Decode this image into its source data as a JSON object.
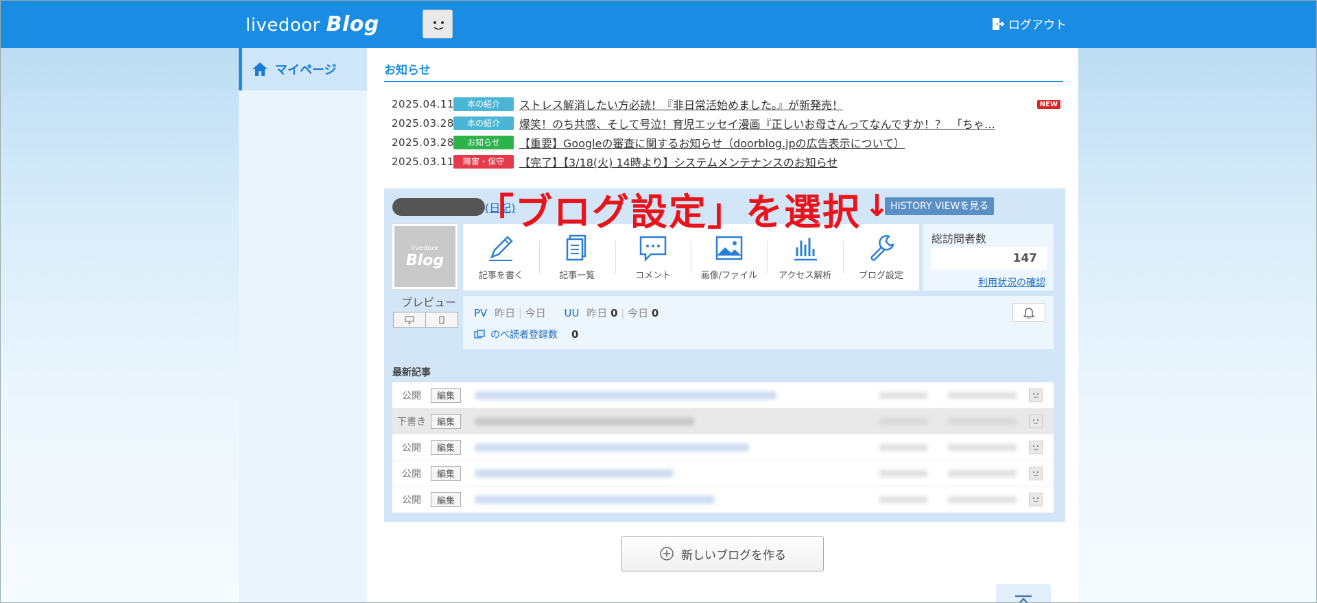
{
  "header": {
    "logo_text": "livedoor",
    "logo_blog": "Blog",
    "logout_label": "ログアウト"
  },
  "sidebar": {
    "items": [
      {
        "label": "マイページ",
        "icon": "home-icon"
      }
    ]
  },
  "news": {
    "title": "お知らせ",
    "items": [
      {
        "date": "2025.04.11",
        "tag": "本の紹介",
        "tag_color": "#4bb5d6",
        "text": "ストレス解消したい方必読！『非日常活始めました。』が新発売！",
        "new": "NEW"
      },
      {
        "date": "2025.03.28",
        "tag": "本の紹介",
        "tag_color": "#4bb5d6",
        "text": "爆笑！のち共感、そして号泣！育児エッセイ漫画『正しいお母さんってなんですか！？　「ちゃ…",
        "new": ""
      },
      {
        "date": "2025.03.28",
        "tag": "お知らせ",
        "tag_color": "#2eb24a",
        "text": "【重要】Googleの審査に関するお知らせ（doorblog.jpの広告表示について）",
        "new": ""
      },
      {
        "date": "2025.03.11",
        "tag": "障害・保守",
        "tag_color": "#e53a4b",
        "text": "【完了】【3/18(火) 14時より】システムメンテナンスのお知らせ",
        "new": ""
      }
    ]
  },
  "blog": {
    "nikki": "(日記)",
    "history_button": "HISTORY VIEWを見る",
    "annotation": "「ブログ設定」を選択",
    "annotation_arrow": "↓",
    "thumb_small": "livedoor",
    "thumb_large": "Blog",
    "preview_label": "プレビュー",
    "actions": [
      {
        "label": "記事を書く",
        "icon": "pencil-icon"
      },
      {
        "label": "記事一覧",
        "icon": "documents-icon"
      },
      {
        "label": "コメント",
        "icon": "comment-icon"
      },
      {
        "label": "画像/ファイル",
        "icon": "image-icon"
      },
      {
        "label": "アクセス解析",
        "icon": "chart-icon"
      },
      {
        "label": "ブログ設定",
        "icon": "wrench-icon"
      }
    ],
    "visitors": {
      "title": "総訪問者数",
      "count": "147",
      "link": "利用状況の確認"
    },
    "stats": {
      "pv": "PV",
      "yesterday": "昨日",
      "today": "今日",
      "uu": "UU",
      "uu_yesterday": "0",
      "uu_today": "0",
      "readers_link": "のべ読者登録数",
      "readers_count": "0"
    },
    "latest_title": "最新記事",
    "posts": [
      {
        "status": "公開",
        "edit": "編集",
        "draft": false
      },
      {
        "status": "下書き",
        "edit": "編集",
        "draft": true
      },
      {
        "status": "公開",
        "edit": "編集",
        "draft": false
      },
      {
        "status": "公開",
        "edit": "編集",
        "draft": false
      },
      {
        "status": "公開",
        "edit": "編集",
        "draft": false
      }
    ],
    "new_blog_button": "新しいブログを作る"
  },
  "colors": {
    "header_blue": "#1a8ce3",
    "annotation_red": "#e8141c"
  }
}
